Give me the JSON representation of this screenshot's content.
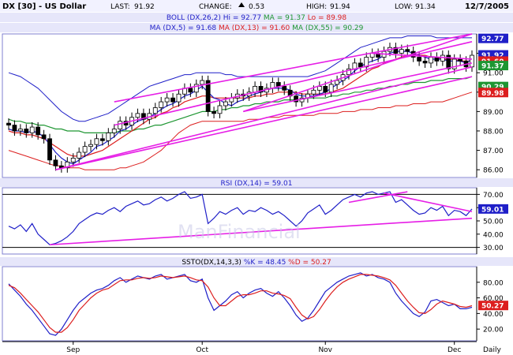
{
  "header": {
    "symbol": "DX [30] - US Dollar",
    "last_label": "LAST:",
    "last_value": "91.92",
    "change_label": "CHANGE:",
    "change_value": "0.53",
    "high_label": "HIGH:",
    "high_value": "91.94",
    "low_label": "LOW:",
    "low_value": "91.34",
    "date": "12/7/2005"
  },
  "watermark": "ManFinancial",
  "colors": {
    "frame": "#7f7fd0",
    "header_bg": "#f2f2ff",
    "legend_bg": "#e6e6fa",
    "price_blue": "#1f1fc8",
    "ma13_red": "#dc1e1e",
    "ma55_green": "#1e9632",
    "trend_magenta": "#e61ee6",
    "candle": "#000000",
    "badge_bg": "#1f1fc8"
  },
  "chart_data": [
    {
      "type": "candlestick",
      "title": "",
      "legend": [
        {
          "text": "BOLL (DX,26,2) Hi = 92.77",
          "color": "#1f1fc8"
        },
        {
          "text": "MA = 91.37",
          "color": "#1e9632"
        },
        {
          "text": "Lo = 89.98",
          "color": "#dc1e1e"
        }
      ],
      "legend2": [
        {
          "text": "MA (DX,5) = 91.68",
          "color": "#1f1fc8"
        },
        {
          "text": "MA (DX,13) = 91.60",
          "color": "#dc1e1e"
        },
        {
          "text": "MA (DX,55) = 90.29",
          "color": "#1e9632"
        }
      ],
      "ylim": [
        85.6,
        93.0
      ],
      "yticks": [
        "86.00",
        "87.00",
        "88.00",
        "89.00",
        "90.00",
        "91.00",
        "92.00"
      ],
      "right_badges": [
        {
          "value": 92.77,
          "text": "92.77",
          "color": "#1f1fc8"
        },
        {
          "value": 91.92,
          "text": "91.92",
          "color": "#1f1fc8"
        },
        {
          "value": 91.6,
          "text": "91.60",
          "color": "#dc1e1e"
        },
        {
          "value": 91.37,
          "text": "91.37",
          "color": "#1e9632"
        },
        {
          "value": 90.29,
          "text": "90.29",
          "color": "#1e9632"
        },
        {
          "value": 89.98,
          "text": "89.98",
          "color": "#dc1e1e"
        }
      ],
      "closes": [
        88.3,
        88.0,
        88.1,
        87.9,
        88.2,
        87.8,
        87.6,
        86.5,
        86.2,
        86.1,
        86.4,
        86.6,
        86.9,
        87.2,
        87.3,
        87.6,
        87.5,
        87.9,
        88.1,
        88.5,
        88.3,
        88.7,
        88.9,
        88.6,
        88.9,
        89.2,
        89.5,
        89.7,
        89.5,
        89.9,
        90.2,
        90.0,
        90.4,
        90.6,
        89.0,
        88.9,
        89.3,
        89.5,
        89.7,
        89.9,
        89.8,
        90.0,
        90.3,
        90.0,
        90.2,
        90.5,
        90.3,
        90.1,
        89.8,
        89.5,
        89.7,
        89.9,
        90.1,
        90.3,
        90.0,
        90.4,
        90.6,
        90.9,
        91.2,
        91.5,
        91.3,
        91.8,
        92.0,
        91.8,
        92.1,
        92.3,
        92.0,
        92.2,
        92.1,
        91.8,
        91.6,
        91.5,
        91.8,
        91.6,
        91.9,
        91.2,
        91.7,
        91.6,
        91.3,
        91.9
      ],
      "ma5": [
        88.1,
        88.0,
        88.0,
        87.9,
        88.0,
        87.9,
        87.7,
        87.3,
        86.9,
        86.6,
        86.4,
        86.3,
        86.5,
        86.7,
        86.9,
        87.2,
        87.3,
        87.5,
        87.7,
        88.0,
        88.1,
        88.3,
        88.5,
        88.6,
        88.7,
        88.9,
        89.1,
        89.3,
        89.4,
        89.6,
        89.8,
        89.9,
        90.1,
        90.3,
        90.0,
        89.7,
        89.6,
        89.4,
        89.3,
        89.5,
        89.6,
        89.8,
        89.9,
        90.0,
        90.1,
        90.2,
        90.2,
        90.2,
        90.1,
        89.9,
        89.8,
        89.8,
        89.8,
        89.9,
        90.0,
        90.2,
        90.4,
        90.6,
        90.8,
        91.1,
        91.3,
        91.5,
        91.6,
        91.7,
        91.9,
        92.0,
        92.1,
        92.1,
        92.1,
        92.0,
        91.9,
        91.8,
        91.7,
        91.7,
        91.7,
        91.6,
        91.6,
        91.6,
        91.5,
        91.7
      ],
      "ma13": [
        88.0,
        87.9,
        87.9,
        87.8,
        87.8,
        87.7,
        87.6,
        87.4,
        87.2,
        87.0,
        86.8,
        86.7,
        86.7,
        86.7,
        86.8,
        86.9,
        87.0,
        87.2,
        87.4,
        87.6,
        87.8,
        88.0,
        88.2,
        88.4,
        88.6,
        88.7,
        88.9,
        89.0,
        89.2,
        89.3,
        89.5,
        89.6,
        89.7,
        89.8,
        89.8,
        89.7,
        89.7,
        89.7,
        89.7,
        89.7,
        89.7,
        89.7,
        89.8,
        89.8,
        89.9,
        89.9,
        90.0,
        90.0,
        90.0,
        90.0,
        89.9,
        89.9,
        89.9,
        89.9,
        89.9,
        90.0,
        90.1,
        90.2,
        90.4,
        90.6,
        90.8,
        91.0,
        91.2,
        91.3,
        91.5,
        91.6,
        91.7,
        91.8,
        91.9,
        91.9,
        91.9,
        91.9,
        91.8,
        91.8,
        91.7,
        91.7,
        91.7,
        91.6,
        91.6,
        91.6
      ],
      "ma55": [
        88.6,
        88.5,
        88.5,
        88.4,
        88.4,
        88.3,
        88.3,
        88.2,
        88.1,
        88.1,
        88.0,
        88.0,
        88.0,
        87.9,
        87.9,
        87.9,
        87.9,
        87.9,
        87.9,
        88.0,
        88.0,
        88.0,
        88.1,
        88.1,
        88.2,
        88.3,
        88.3,
        88.4,
        88.5,
        88.6,
        88.7,
        88.8,
        88.9,
        89.0,
        89.0,
        89.0,
        89.1,
        89.1,
        89.2,
        89.2,
        89.3,
        89.3,
        89.4,
        89.4,
        89.5,
        89.5,
        89.5,
        89.6,
        89.6,
        89.6,
        89.6,
        89.7,
        89.7,
        89.7,
        89.7,
        89.8,
        89.8,
        89.9,
        89.9,
        90.0,
        90.0,
        90.1,
        90.1,
        90.2,
        90.2,
        90.3,
        90.3,
        90.4,
        90.4,
        90.5,
        90.5,
        90.5,
        90.6,
        90.6,
        90.6,
        90.7,
        90.7,
        90.7,
        90.7,
        90.8
      ],
      "upper": [
        91.0,
        90.9,
        90.8,
        90.6,
        90.4,
        90.2,
        89.9,
        89.6,
        89.3,
        89.0,
        88.8,
        88.6,
        88.5,
        88.5,
        88.6,
        88.7,
        88.8,
        88.9,
        89.1,
        89.3,
        89.5,
        89.7,
        89.9,
        90.1,
        90.3,
        90.4,
        90.5,
        90.6,
        90.7,
        90.8,
        90.9,
        90.9,
        91.0,
        91.0,
        91.0,
        91.0,
        91.0,
        90.9,
        90.9,
        90.8,
        90.8,
        90.8,
        90.8,
        90.8,
        90.8,
        90.8,
        90.8,
        90.8,
        90.8,
        90.8,
        90.8,
        90.8,
        90.9,
        91.0,
        91.1,
        91.3,
        91.5,
        91.7,
        91.9,
        92.1,
        92.3,
        92.4,
        92.5,
        92.6,
        92.7,
        92.8,
        92.8,
        92.8,
        92.9,
        92.9,
        92.9,
        92.9,
        92.9,
        92.8,
        92.8,
        92.8,
        92.8,
        92.8,
        92.8,
        92.8
      ],
      "lower": [
        87.0,
        86.9,
        86.8,
        86.7,
        86.6,
        86.5,
        86.4,
        86.3,
        86.2,
        86.2,
        86.1,
        86.1,
        86.1,
        86.0,
        86.0,
        86.0,
        86.0,
        86.0,
        86.0,
        86.1,
        86.1,
        86.2,
        86.3,
        86.4,
        86.6,
        86.8,
        87.0,
        87.3,
        87.6,
        87.9,
        88.1,
        88.3,
        88.4,
        88.5,
        88.5,
        88.5,
        88.5,
        88.5,
        88.5,
        88.5,
        88.5,
        88.6,
        88.6,
        88.6,
        88.7,
        88.7,
        88.7,
        88.8,
        88.8,
        88.8,
        88.8,
        88.8,
        88.8,
        88.9,
        88.9,
        88.9,
        88.9,
        89.0,
        89.0,
        89.0,
        89.1,
        89.1,
        89.1,
        89.2,
        89.2,
        89.2,
        89.3,
        89.3,
        89.3,
        89.4,
        89.4,
        89.4,
        89.5,
        89.5,
        89.5,
        89.6,
        89.7,
        89.8,
        89.9,
        90.0
      ],
      "trendlines": [
        {
          "from": [
            8,
            86.0
          ],
          "to": [
            79,
            90.8
          ]
        },
        {
          "from": [
            8,
            86.0
          ],
          "to": [
            79,
            91.3
          ]
        },
        {
          "from": [
            18,
            88.3
          ],
          "to": [
            79,
            92.6
          ]
        },
        {
          "from": [
            18,
            89.5
          ],
          "to": [
            79,
            93.0
          ]
        },
        {
          "from": [
            40,
            89.0
          ],
          "to": [
            79,
            91.5
          ]
        },
        {
          "from": [
            40,
            89.0
          ],
          "to": [
            79,
            93.0
          ]
        },
        {
          "from": [
            62,
            92.0
          ],
          "to": [
            79,
            91.7
          ]
        }
      ]
    },
    {
      "type": "line",
      "title": "RSI (DX,14) = 59.01",
      "ylim": [
        25,
        75
      ],
      "yticks": [
        "30.00",
        "40.00",
        "50.00",
        "60.00",
        "70.00"
      ],
      "ref_lines": [
        70,
        30
      ],
      "badge": {
        "value": 59.01,
        "text": "59.01"
      },
      "values": [
        46,
        44,
        47,
        42,
        48,
        40,
        36,
        32,
        33,
        35,
        38,
        42,
        48,
        51,
        54,
        56,
        55,
        58,
        60,
        57,
        61,
        63,
        65,
        62,
        63,
        66,
        68,
        65,
        67,
        70,
        72,
        67,
        68,
        70,
        48,
        52,
        57,
        55,
        58,
        60,
        55,
        58,
        57,
        60,
        58,
        55,
        57,
        54,
        50,
        46,
        50,
        56,
        59,
        62,
        55,
        58,
        62,
        66,
        68,
        70,
        68,
        71,
        72,
        70,
        71,
        72,
        64,
        66,
        62,
        58,
        55,
        56,
        60,
        58,
        61,
        54,
        58,
        57,
        54,
        59
      ],
      "trendlines": [
        {
          "from": [
            7,
            32
          ],
          "to": [
            79,
            52
          ]
        },
        {
          "from": [
            58,
            64
          ],
          "to": [
            68,
            72
          ]
        },
        {
          "from": [
            64,
            71
          ],
          "to": [
            79,
            57
          ]
        }
      ]
    },
    {
      "type": "line",
      "title": "SSTO(DX,14,3,3) %K = 48.45 %D = 50.27",
      "ylim": [
        5,
        100
      ],
      "yticks": [
        "20.00",
        "40.00",
        "60.00",
        "80.00"
      ],
      "ref_lines": [],
      "badges": [
        {
          "value": 50.27,
          "text": "50.27",
          "color": "#dc1e1e"
        }
      ],
      "series": [
        {
          "name": "%K = 48.45",
          "color": "#1f1fc8",
          "values": [
            78,
            70,
            62,
            52,
            44,
            34,
            24,
            14,
            12,
            20,
            32,
            44,
            54,
            60,
            66,
            70,
            72,
            76,
            82,
            86,
            80,
            84,
            88,
            86,
            84,
            88,
            90,
            84,
            86,
            88,
            90,
            82,
            80,
            84,
            60,
            44,
            50,
            56,
            64,
            68,
            60,
            66,
            70,
            72,
            66,
            62,
            68,
            60,
            50,
            38,
            30,
            34,
            44,
            56,
            68,
            74,
            80,
            84,
            88,
            90,
            92,
            88,
            90,
            86,
            84,
            80,
            66,
            56,
            48,
            40,
            36,
            42,
            56,
            58,
            54,
            50,
            52,
            46,
            46,
            48
          ]
        },
        {
          "name": "%D = 50.27",
          "color": "#dc1e1e",
          "values": [
            76,
            73,
            66,
            58,
            50,
            42,
            32,
            22,
            16,
            16,
            22,
            32,
            44,
            52,
            60,
            66,
            70,
            72,
            77,
            82,
            83,
            83,
            85,
            86,
            85,
            86,
            88,
            87,
            86,
            87,
            88,
            86,
            83,
            82,
            74,
            60,
            50,
            50,
            56,
            62,
            64,
            64,
            66,
            69,
            69,
            66,
            65,
            63,
            59,
            48,
            38,
            33,
            36,
            45,
            56,
            66,
            74,
            80,
            84,
            87,
            90,
            90,
            89,
            88,
            86,
            83,
            76,
            66,
            56,
            48,
            41,
            40,
            45,
            52,
            56,
            54,
            52,
            49,
            48,
            50
          ]
        }
      ]
    }
  ],
  "x_axis": {
    "months": [
      {
        "label": "Sep",
        "index": 11
      },
      {
        "label": "Oct",
        "index": 33
      },
      {
        "label": "Nov",
        "index": 54
      },
      {
        "label": "Dec",
        "index": 76
      }
    ],
    "period": "Daily"
  }
}
